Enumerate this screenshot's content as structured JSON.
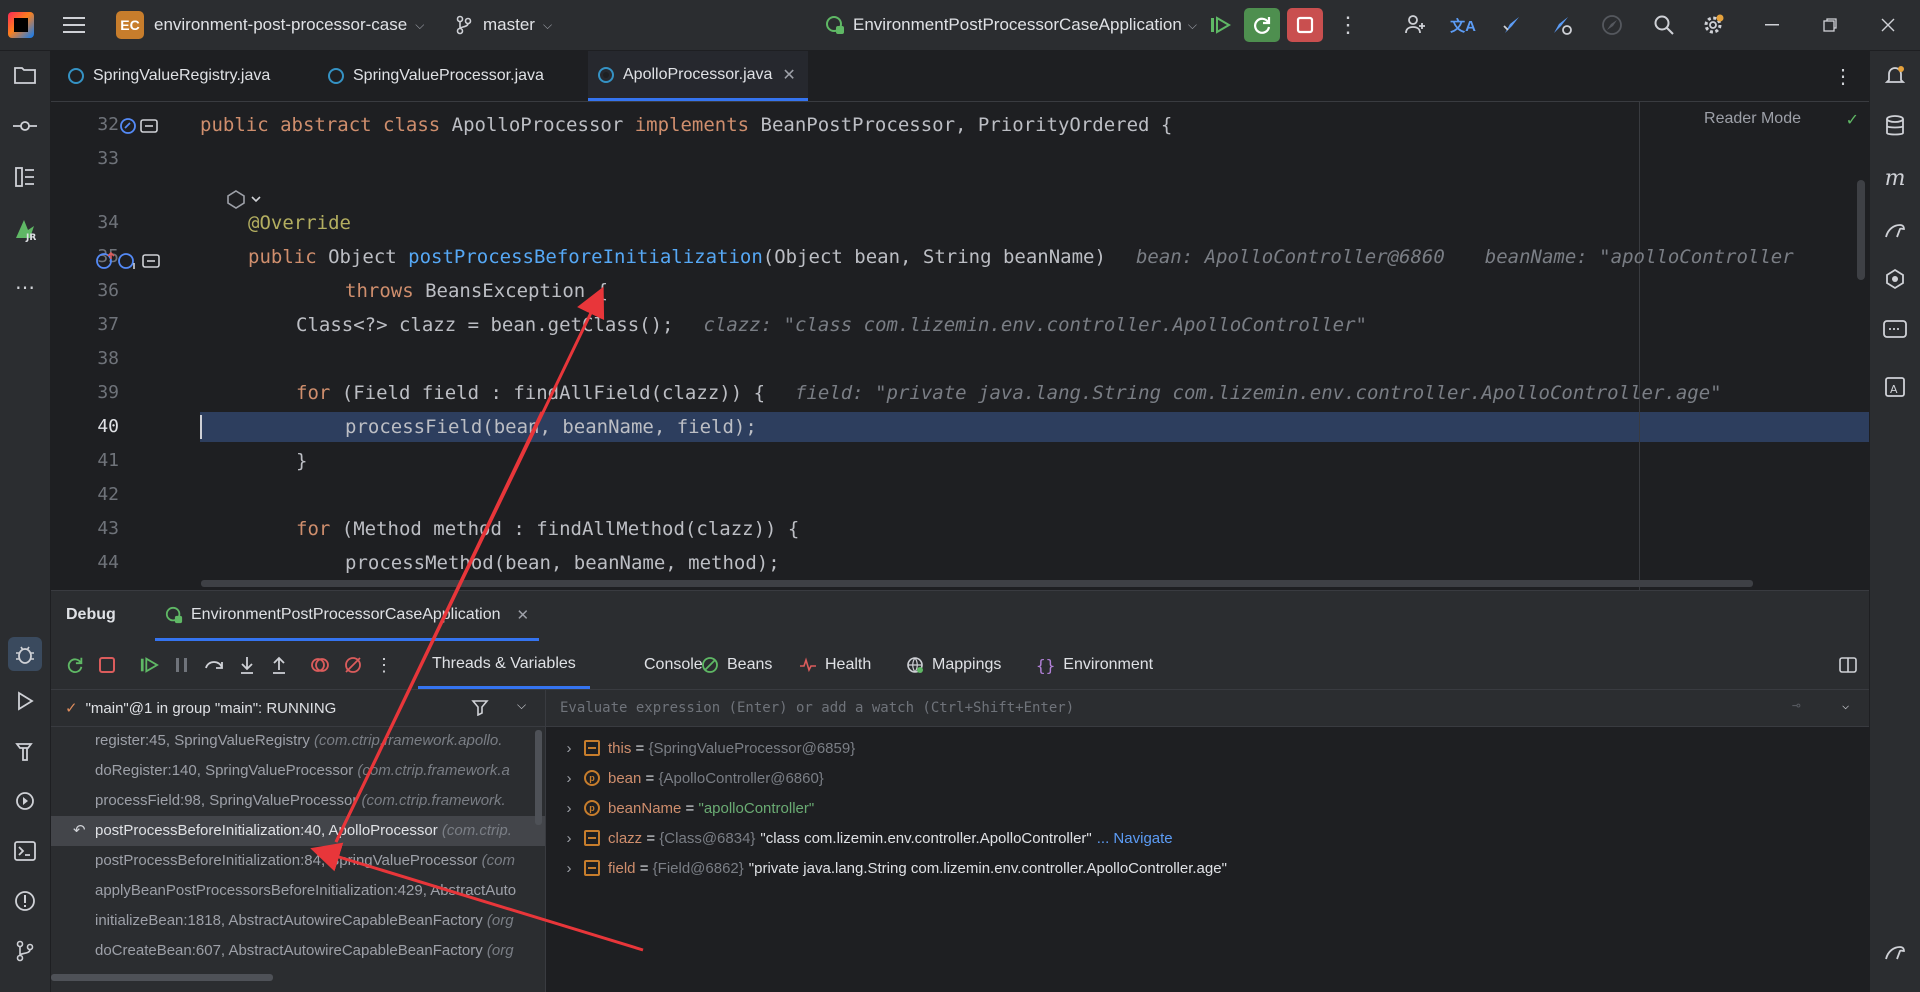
{
  "titlebar": {
    "project_badge": "EC",
    "project_name": "environment-post-processor-case",
    "branch": "master",
    "run_config": "EnvironmentPostProcessorCaseApplication"
  },
  "tabs": [
    {
      "label": "SpringValueRegistry.java"
    },
    {
      "label": "SpringValueProcessor.java"
    },
    {
      "label": "ApolloProcessor.java"
    }
  ],
  "editor": {
    "reader_mode": "Reader Mode",
    "lines": [
      {
        "num": "32"
      },
      {
        "num": "33"
      },
      {
        "num": ""
      },
      {
        "num": "34"
      },
      {
        "num": "35"
      },
      {
        "num": "36"
      },
      {
        "num": "37"
      },
      {
        "num": "38"
      },
      {
        "num": "39"
      },
      {
        "num": "40"
      },
      {
        "num": "41"
      },
      {
        "num": "42"
      },
      {
        "num": "43"
      },
      {
        "num": "44"
      }
    ],
    "code": {
      "l32_kw1": "public abstract class ",
      "l32_name": "ApolloProcessor ",
      "l32_kw2": "implements ",
      "l32_rest": "BeanPostProcessor, PriorityOrdered {",
      "l34_ann": "@Override",
      "l35_kw": "public ",
      "l35_type": "Object ",
      "l35_fn": "postProcessBeforeInitialization",
      "l35_args": "(Object bean, String beanName)",
      "l35_hint1": "bean: ApolloController@6860",
      "l35_hint2": "beanName: \"apolloController",
      "l36_kw": "throws ",
      "l36_rest": "BeansException {",
      "l37_code": "Class<?> clazz = bean.getClass();",
      "l37_hint": "clazz: \"class com.lizemin.env.controller.ApolloController\"",
      "l39_kw": "for ",
      "l39_rest": "(Field field : findAllField(clazz)) {",
      "l39_hint": "field: \"private java.lang.String com.lizemin.env.controller.ApolloController.age\"",
      "l40_code": "processField(bean, beanName, field);",
      "l41_code": "}",
      "l43_kw": "for ",
      "l43_rest": "(Method method : findAllMethod(clazz)) {",
      "l44_code": "processMethod(bean, beanName, method);"
    }
  },
  "debug": {
    "title": "Debug",
    "session": "EnvironmentPostProcessorCaseApplication",
    "tabs": [
      "Threads & Variables",
      "Console",
      "Beans",
      "Health",
      "Mappings",
      "Environment"
    ],
    "thread": "\"main\"@1 in group \"main\": RUNNING",
    "eval_placeholder": "Evaluate expression (Enter) or add a watch (Ctrl+Shift+Enter)",
    "frames": [
      {
        "method": "register:45, SpringValueRegistry ",
        "pkg": "(com.ctrip.framework.apollo."
      },
      {
        "method": "doRegister:140, SpringValueProcessor ",
        "pkg": "(com.ctrip.framework.a"
      },
      {
        "method": "processField:98, SpringValueProcessor ",
        "pkg": "(com.ctrip.framework."
      },
      {
        "method": "postProcessBeforeInitialization:40, ApolloProcessor ",
        "pkg": "(com.ctrip."
      },
      {
        "method": "postProcessBeforeInitialization:84, SpringValueProcessor ",
        "pkg": "(com"
      },
      {
        "method": "applyBeanPostProcessorsBeforeInitialization:429, AbstractAuto",
        "pkg": ""
      },
      {
        "method": "initializeBean:1818, AbstractAutowireCapableBeanFactory ",
        "pkg": "(org"
      },
      {
        "method": "doCreateBean:607, AbstractAutowireCapableBeanFactory ",
        "pkg": "(org"
      }
    ],
    "variables": [
      {
        "name": "this",
        "type": "{SpringValueProcessor@6859}",
        "value": "",
        "link": ""
      },
      {
        "name": "bean",
        "type": "{ApolloController@6860}",
        "value": "",
        "link": ""
      },
      {
        "name": "beanName",
        "type": "",
        "value": "\"apolloController\"",
        "link": ""
      },
      {
        "name": "clazz",
        "type": "{Class@6834}",
        "value": "\"class com.lizemin.env.controller.ApolloController\"",
        "link": "... Navigate"
      },
      {
        "name": "field",
        "type": "{Field@6862}",
        "value": "\"private java.lang.String com.lizemin.env.controller.ApolloController.age\"",
        "link": ""
      }
    ],
    "eq": " = "
  },
  "colors": {
    "accent": "#3574f0",
    "exec_line": "#2d3e5e",
    "stop": "#db5c5c",
    "run": "#5fb865",
    "annotation_arrow": "#e8363a"
  }
}
